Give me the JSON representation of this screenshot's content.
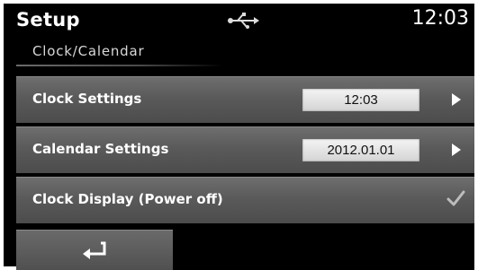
{
  "header": {
    "title": "Setup",
    "clock": "12:03",
    "status_icon": "usb-icon"
  },
  "section": {
    "title": "Clock/Calendar"
  },
  "rows": [
    {
      "label": "Clock Settings",
      "value": "12:03",
      "icon": "chevron-right-icon"
    },
    {
      "label": "Calendar Settings",
      "value": "2012.01.01",
      "icon": "chevron-right-icon"
    },
    {
      "label": "Clock Display (Power off)",
      "icon": "check-icon",
      "checked": true
    }
  ],
  "footer": {
    "back_icon": "back-arrow-icon"
  },
  "colors": {
    "background": "#000000",
    "row": "#5a5a5a",
    "text": "#ffffff",
    "value_box": "#e6e6e6"
  }
}
